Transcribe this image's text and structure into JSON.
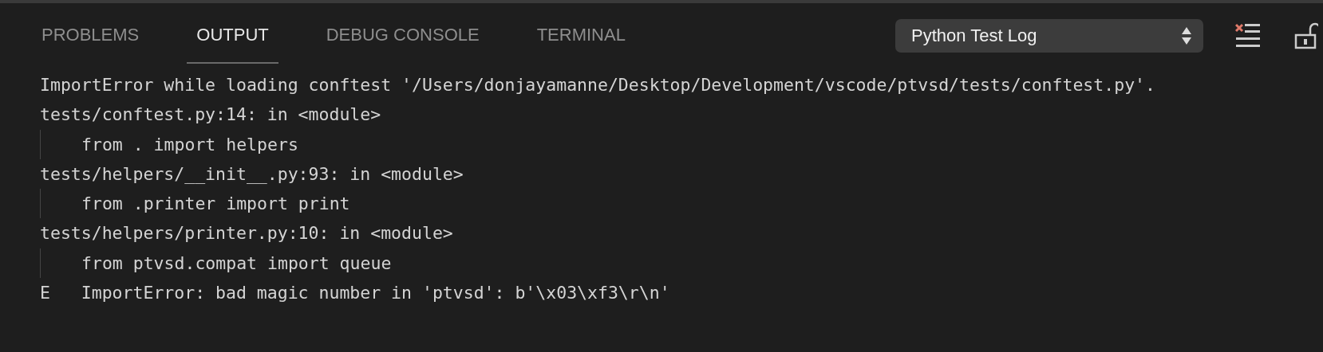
{
  "tabs": [
    {
      "label": "PROBLEMS",
      "selected": false
    },
    {
      "label": "OUTPUT",
      "selected": true
    },
    {
      "label": "DEBUG CONSOLE",
      "selected": false
    },
    {
      "label": "TERMINAL",
      "selected": false
    }
  ],
  "channel_select": {
    "value": "Python Test Log"
  },
  "output_lines": [
    {
      "kind": "plain",
      "text": "ImportError while loading conftest '/Users/donjayamanne/Desktop/Development/vscode/ptvsd/tests/conftest.py'."
    },
    {
      "kind": "plain",
      "text": "tests/conftest.py:14: in <module>"
    },
    {
      "kind": "indented",
      "text": "from . import helpers"
    },
    {
      "kind": "plain",
      "text": "tests/helpers/__init__.py:93: in <module>"
    },
    {
      "kind": "indented",
      "text": "from .printer import print"
    },
    {
      "kind": "plain",
      "text": "tests/helpers/printer.py:10: in <module>"
    },
    {
      "kind": "indented",
      "text": "from ptvsd.compat import queue"
    },
    {
      "kind": "plain",
      "text": "E   ImportError: bad magic number in 'ptvsd': b'\\x03\\xf3\\r\\n'"
    }
  ]
}
